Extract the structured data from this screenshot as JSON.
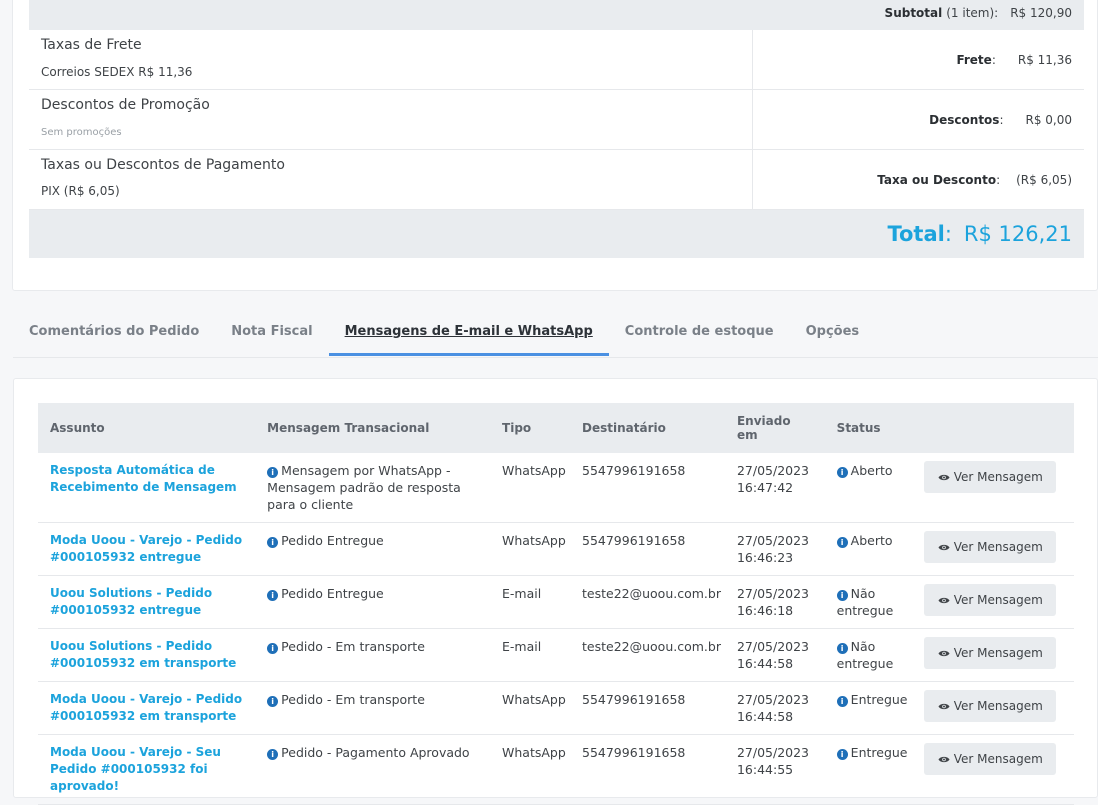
{
  "summary": {
    "subtotal_label": "Subtotal",
    "subtotal_count": "(1 item):",
    "subtotal_value": "R$ 120,90",
    "shipping": {
      "title": "Taxas de Frete",
      "detail": "Correios SEDEX R$ 11,36",
      "label": "Frete",
      "value": "R$ 11,36"
    },
    "discount": {
      "title": "Descontos de Promoção",
      "detail": "Sem promoções",
      "label": "Descontos",
      "value": "R$ 0,00"
    },
    "payment": {
      "title": "Taxas ou Descontos de Pagamento",
      "detail": "PIX (R$ 6,05)",
      "label": "Taxa ou Desconto",
      "value": "(R$ 6,05)"
    },
    "total_label": "Total",
    "total_value": "R$ 126,21"
  },
  "tabs": [
    {
      "label": "Comentários do Pedido"
    },
    {
      "label": "Nota Fiscal"
    },
    {
      "label": "Mensagens de E-mail e WhatsApp"
    },
    {
      "label": "Controle de estoque"
    },
    {
      "label": "Opções"
    }
  ],
  "messages": {
    "headers": [
      "Assunto",
      "Mensagem Transacional",
      "Tipo",
      "Destinatário",
      "Enviado em",
      "Status",
      ""
    ],
    "view_label": "Ver Mensagem",
    "rows": [
      {
        "subject": "Resposta Automática de Recebimento de Mensagem",
        "message": "Mensagem por WhatsApp - Mensagem padrão de resposta para o cliente",
        "type": "WhatsApp",
        "recipient": "5547996191658",
        "date": "27/05/2023",
        "time": "16:47:42",
        "status": "Aberto"
      },
      {
        "subject": "Moda Uoou - Varejo - Pedido #000105932 entregue",
        "message": "Pedido Entregue",
        "type": "WhatsApp",
        "recipient": "5547996191658",
        "date": "27/05/2023",
        "time": "16:46:23",
        "status": "Aberto"
      },
      {
        "subject": "Uoou Solutions - Pedido #000105932 entregue",
        "message": "Pedido Entregue",
        "type": "E-mail",
        "recipient": "teste22@uoou.com.br",
        "date": "27/05/2023",
        "time": "16:46:18",
        "status": "Não entregue"
      },
      {
        "subject": "Uoou Solutions - Pedido #000105932 em transporte",
        "message": "Pedido - Em transporte",
        "type": "E-mail",
        "recipient": "teste22@uoou.com.br",
        "date": "27/05/2023",
        "time": "16:44:58",
        "status": "Não entregue"
      },
      {
        "subject": "Moda Uoou - Varejo - Pedido #000105932 em transporte",
        "message": "Pedido - Em transporte",
        "type": "WhatsApp",
        "recipient": "5547996191658",
        "date": "27/05/2023",
        "time": "16:44:58",
        "status": "Entregue"
      },
      {
        "subject": "Moda Uoou - Varejo - Seu Pedido #000105932 foi aprovado!",
        "message": "Pedido - Pagamento Aprovado",
        "type": "WhatsApp",
        "recipient": "5547996191658",
        "date": "27/05/2023",
        "time": "16:44:55",
        "status": "Entregue"
      }
    ]
  }
}
